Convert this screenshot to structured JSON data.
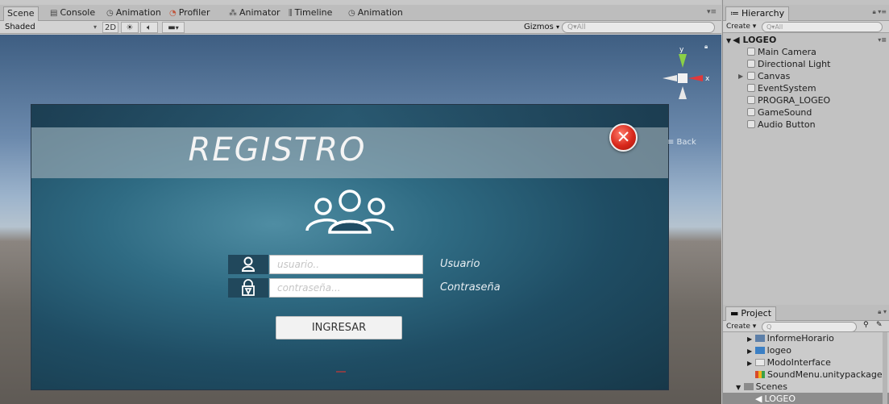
{
  "scene_tabs": [
    {
      "label": "Scene",
      "icon": ""
    },
    {
      "label": "Console",
      "icon": "console-icon"
    },
    {
      "label": "Animation",
      "icon": "clock-icon"
    },
    {
      "label": "Profiler",
      "icon": "profiler-icon"
    },
    {
      "label": "Animator",
      "icon": "animator-icon"
    },
    {
      "label": "Timeline",
      "icon": "timeline-icon"
    },
    {
      "label": "Animation",
      "icon": "clock-icon"
    }
  ],
  "scene_toolbar": {
    "shading_mode": "Shaded",
    "mode_2d": "2D",
    "gizmos": "Gizmos",
    "search_placeholder": "Q▾All"
  },
  "game_ui": {
    "title": "REGISTRO",
    "username_placeholder": "usuario..",
    "username_label": "Usuario",
    "password_placeholder": "contraseña...",
    "password_label": "Contraseña",
    "submit_label": "INGRESAR",
    "back_label": "≡ Back"
  },
  "gizmo": {
    "y_label": "y",
    "x_label": "x"
  },
  "hierarchy": {
    "tab_label": "Hierarchy",
    "create_label": "Create ▾",
    "search_placeholder": "Q▾All",
    "scene_name": "LOGEO",
    "items": [
      "Main Camera",
      "Directional Light",
      "Canvas",
      "EventSystem",
      "PROGRA_LOGEO",
      "GameSound",
      "Audio Button"
    ]
  },
  "project": {
    "tab_label": "Project",
    "create_label": "Create ▾",
    "search_placeholder": "Q",
    "items": [
      "InformeHorario",
      "logeo",
      "ModoInterface",
      "SoundMenu.unitypackage",
      "Scenes",
      "LOGEO"
    ]
  },
  "colors": {
    "canvas_dark": "#173849",
    "canvas_light": "#4f8da3",
    "close_red": "#d8281b",
    "icon_box": "#21485c",
    "selected_row": "#8d8d8d"
  }
}
